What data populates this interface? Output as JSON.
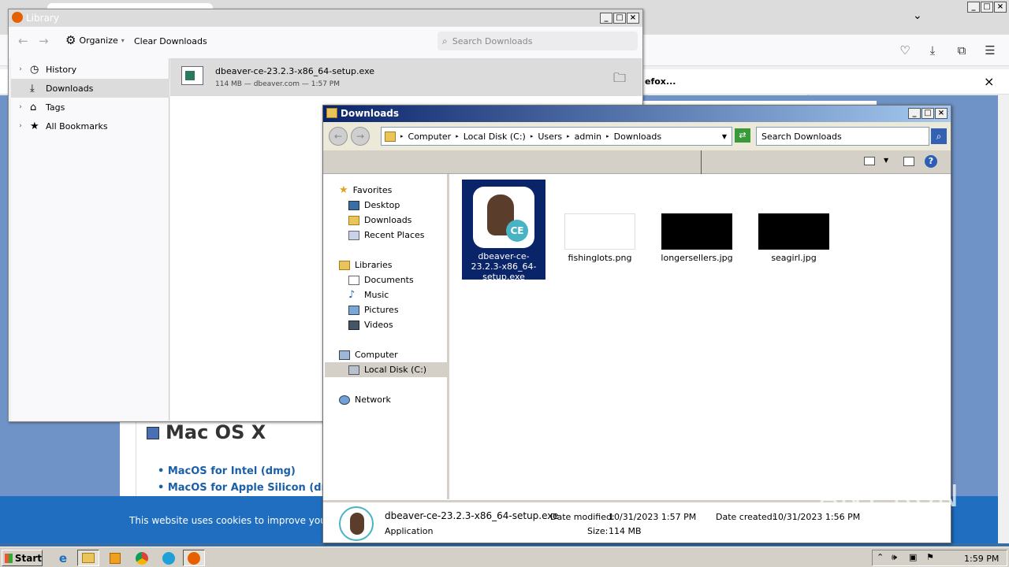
{
  "firefox": {
    "notice_text": "efox...",
    "page": {
      "section_title": "Mac OS X",
      "links": [
        "MacOS for Intel (dmg)",
        "MacOS for Apple Silicon (dm"
      ]
    },
    "cookie_text": "This website uses cookies to improve your"
  },
  "library": {
    "title": "Library",
    "toolbar": {
      "organize": "Organize",
      "clear": "Clear Downloads",
      "search_placeholder": "Search Downloads"
    },
    "sidebar": [
      {
        "label": "History",
        "icon": "clock-icon"
      },
      {
        "label": "Downloads",
        "icon": "download-icon"
      },
      {
        "label": "Tags",
        "icon": "tag-icon"
      },
      {
        "label": "All Bookmarks",
        "icon": "star-icon"
      }
    ],
    "downloads": [
      {
        "name": "dbeaver-ce-23.2.3-x86_64-setup.exe",
        "meta": "114 MB — dbeaver.com — 1:57 PM"
      }
    ]
  },
  "explorer": {
    "title": "Downloads",
    "breadcrumb": [
      "Computer",
      "Local Disk (C:)",
      "Users",
      "admin",
      "Downloads"
    ],
    "search_placeholder": "Search Downloads",
    "nav": {
      "favorites": "Favorites",
      "favorites_items": [
        "Desktop",
        "Downloads",
        "Recent Places"
      ],
      "libraries": "Libraries",
      "libraries_items": [
        "Documents",
        "Music",
        "Pictures",
        "Videos"
      ],
      "computer": "Computer",
      "computer_items": [
        "Local Disk (C:)"
      ],
      "network": "Network"
    },
    "files": [
      {
        "name": "dbeaver-ce-23.2.3-x86_64-setup.exe",
        "kind": "exe"
      },
      {
        "name": "fishinglots.png",
        "kind": "png"
      },
      {
        "name": "longersellers.jpg",
        "kind": "jpg"
      },
      {
        "name": "seagirl.jpg",
        "kind": "jpg"
      }
    ],
    "details": {
      "name": "dbeaver-ce-23.2.3-x86_64-setup.exe",
      "type": "Application",
      "modified_label": "Date modified:",
      "modified": "10/31/2023 1:57 PM",
      "size_label": "Size:",
      "size": "114 MB",
      "created_label": "Date created:",
      "created": "10/31/2023 1:56 PM"
    }
  },
  "taskbar": {
    "start": "Start",
    "clock": "1:59 PM"
  },
  "watermark": "ANY RUN"
}
